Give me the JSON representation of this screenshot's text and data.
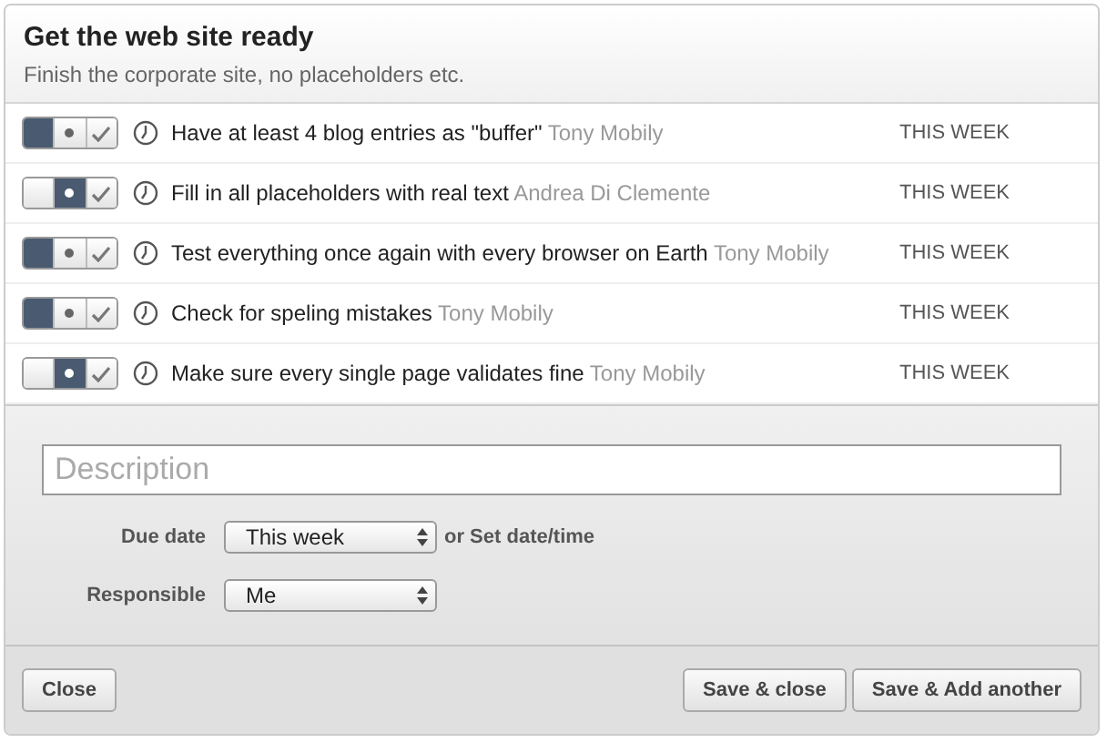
{
  "header": {
    "title": "Get the web site ready",
    "subtitle": "Finish the corporate site, no placeholders etc."
  },
  "tasks": [
    {
      "toggle": [
        {
          "selected": true
        },
        {
          "selected": false
        },
        {
          "selected": false
        }
      ],
      "text": "Have at least 4 blog entries as \"buffer\"",
      "person": "Tony Mobily",
      "due": "THIS WEEK"
    },
    {
      "toggle": [
        {
          "selected": false
        },
        {
          "selected": true
        },
        {
          "selected": false
        }
      ],
      "text": "Fill in all placeholders with real text",
      "person": "Andrea Di Clemente",
      "due": "THIS WEEK"
    },
    {
      "toggle": [
        {
          "selected": true
        },
        {
          "selected": false
        },
        {
          "selected": false
        }
      ],
      "text": "Test everything once again with every browser on Earth",
      "person": "Tony Mobily",
      "due": "THIS WEEK"
    },
    {
      "toggle": [
        {
          "selected": true
        },
        {
          "selected": false
        },
        {
          "selected": false
        }
      ],
      "text": "Check for speling mistakes",
      "person": "Tony Mobily",
      "due": "THIS WEEK"
    },
    {
      "toggle": [
        {
          "selected": false
        },
        {
          "selected": true
        },
        {
          "selected": false
        }
      ],
      "text": "Make sure every single page validates fine",
      "person": "Tony Mobily",
      "due": "THIS WEEK"
    }
  ],
  "form": {
    "description": {
      "placeholder": "Description"
    },
    "due_date": {
      "label": "Due date",
      "value": "This week",
      "link": "or Set date/time"
    },
    "responsible": {
      "label": "Responsible",
      "value": "Me"
    }
  },
  "buttons": {
    "close": "Close",
    "save_close": "Save & close",
    "save_add": "Save & Add another"
  }
}
